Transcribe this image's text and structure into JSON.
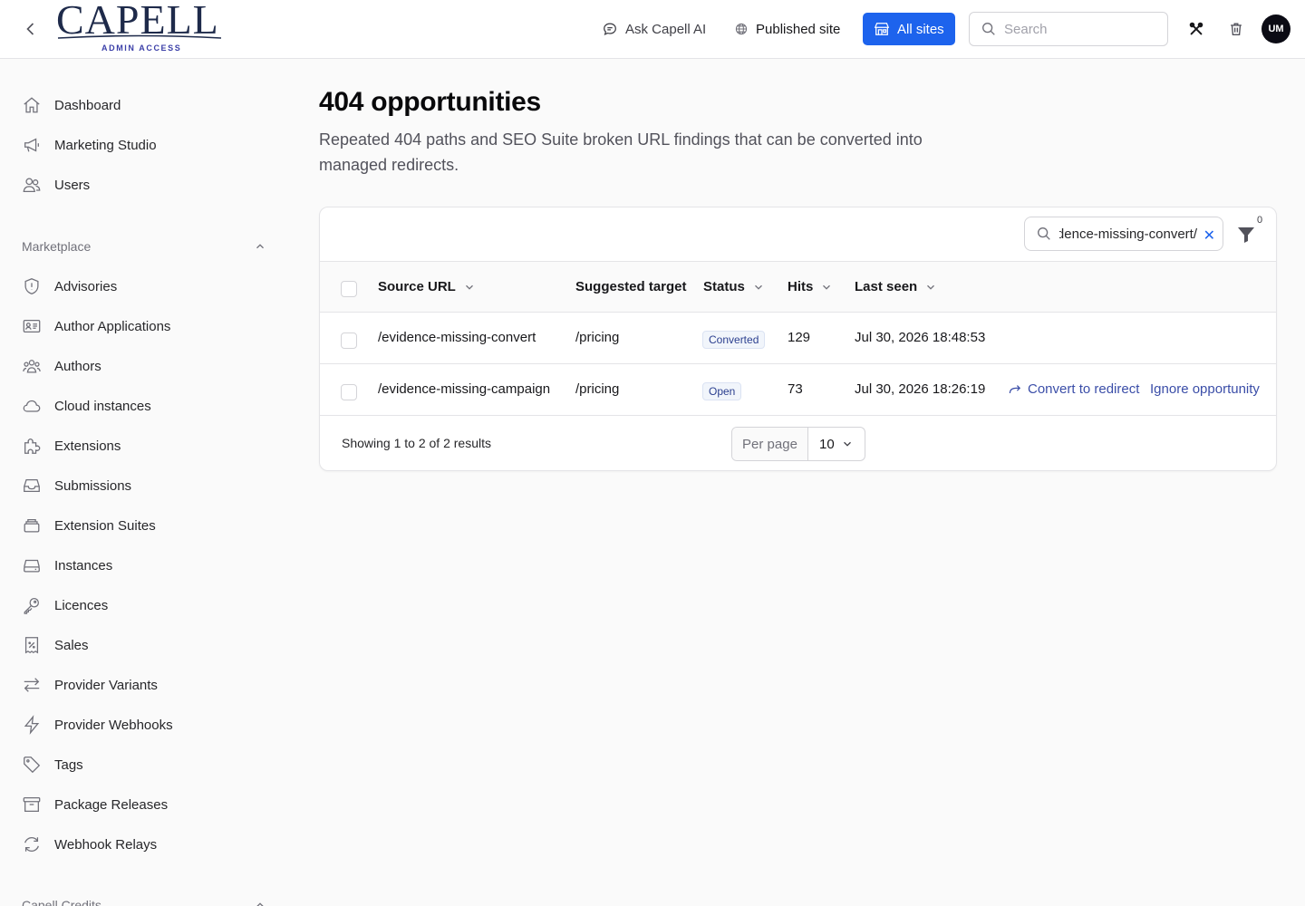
{
  "topbar": {
    "logo_text": "CAPELL",
    "logo_subtitle": "ADMIN ACCESS",
    "ask_ai": "Ask Capell AI",
    "published_site": "Published site",
    "all_sites": "All sites",
    "search_placeholder": "Search",
    "avatar_initials": "UM",
    "accent_color": "#1d63ed"
  },
  "sidebar": {
    "items_top": [
      {
        "label": "Dashboard",
        "icon": "home-icon"
      },
      {
        "label": "Marketing Studio",
        "icon": "megaphone-icon"
      },
      {
        "label": "Users",
        "icon": "users-icon"
      }
    ],
    "marketplace_label": "Marketplace",
    "items_marketplace": [
      {
        "label": "Advisories",
        "icon": "shield-icon"
      },
      {
        "label": "Author Applications",
        "icon": "id-card-icon"
      },
      {
        "label": "Authors",
        "icon": "user-group-icon"
      },
      {
        "label": "Cloud instances",
        "icon": "cloud-icon"
      },
      {
        "label": "Extensions",
        "icon": "puzzle-icon"
      },
      {
        "label": "Submissions",
        "icon": "inbox-icon"
      },
      {
        "label": "Extension Suites",
        "icon": "stack-icon"
      },
      {
        "label": "Instances",
        "icon": "server-icon"
      },
      {
        "label": "Licences",
        "icon": "key-icon"
      },
      {
        "label": "Sales",
        "icon": "receipt-percent-icon"
      },
      {
        "label": "Provider Variants",
        "icon": "arrows-right-left-icon"
      },
      {
        "label": "Provider Webhooks",
        "icon": "bolt-icon"
      },
      {
        "label": "Tags",
        "icon": "tag-icon"
      },
      {
        "label": "Package Releases",
        "icon": "archive-box-icon"
      },
      {
        "label": "Webhook Relays",
        "icon": "refresh-icon"
      }
    ],
    "credits_label": "Capell Credits"
  },
  "main": {
    "title": "404 opportunities",
    "description": "Repeated 404 paths and SEO Suite broken URL findings that can be converted into managed redirects.",
    "filter_search_value": "/evidence-missing-convert",
    "filter_count": "0",
    "columns": {
      "source_url": "Source URL",
      "suggested_target": "Suggested target",
      "status": "Status",
      "hits": "Hits",
      "last_seen": "Last seen"
    },
    "rows": [
      {
        "source": "/evidence-missing-convert",
        "target": "/pricing",
        "status": "Converted",
        "hits": "129",
        "last_seen": "Jul 30, 2026 18:48:53"
      },
      {
        "source": "/evidence-missing-campaign",
        "target": "/pricing",
        "status": "Open",
        "hits": "73",
        "last_seen": "Jul 30, 2026 18:26:19",
        "action_convert": "Convert to redirect",
        "action_ignore": "Ignore opportunity"
      }
    ],
    "footer_text": "Showing 1 to 2 of 2 results",
    "per_page_label": "Per page",
    "per_page_value": "10"
  }
}
